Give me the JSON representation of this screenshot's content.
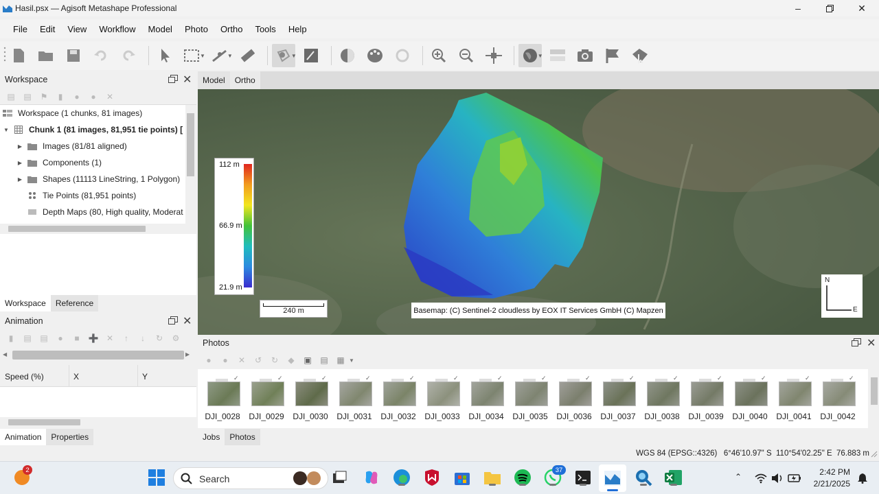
{
  "window": {
    "title": "Hasil.psx — Agisoft Metashape Professional",
    "controls": [
      "minimize-icon",
      "restore-icon",
      "close-icon"
    ]
  },
  "menubar": {
    "items": [
      {
        "label": "File"
      },
      {
        "label": "Edit"
      },
      {
        "label": "View"
      },
      {
        "label": "Workflow"
      },
      {
        "label": "Model"
      },
      {
        "label": "Photo"
      },
      {
        "label": "Ortho"
      },
      {
        "label": "Tools"
      },
      {
        "label": "Help"
      }
    ]
  },
  "toolbar": {
    "icons": [
      "new-document-icon",
      "open-folder-icon",
      "save-icon",
      "undo-icon",
      "redo-icon",
      "select-pointer-icon",
      "rectangle-selection-icon",
      "ruler-line-icon",
      "ruler-icon",
      "shape-draw-icon",
      "edit-patch-icon",
      "hillshade-icon",
      "palette-icon",
      "refresh-icon",
      "zoom-in-icon",
      "zoom-out-icon",
      "move-icon",
      "globe-icon",
      "layers-icon",
      "camera-icon",
      "flag-icon",
      "shape-select-icon"
    ]
  },
  "workspace": {
    "title": "Workspace",
    "root": "Workspace (1 chunks, 81 images)",
    "chunk": "Chunk 1 (81 images, 81,951 tie points) [",
    "items": [
      {
        "label": "Images (81/81 aligned)",
        "icon": "folder-icon"
      },
      {
        "label": "Components (1)",
        "icon": "folder-icon"
      },
      {
        "label": "Shapes (11113 LineString, 1 Polygon)",
        "icon": "folder-icon"
      },
      {
        "label": "Tie Points (81,951 points)",
        "icon": "tie-points-icon"
      },
      {
        "label": "Depth Maps (80, High quality, Moderat",
        "icon": "depth-maps-icon"
      }
    ],
    "tabs": [
      {
        "label": "Workspace",
        "selected": true
      },
      {
        "label": "Reference",
        "selected": false
      }
    ]
  },
  "animation": {
    "title": "Animation",
    "columns": [
      "Speed (%)",
      "X",
      "Y"
    ],
    "tabs": [
      {
        "label": "Animation",
        "selected": true
      },
      {
        "label": "Properties",
        "selected": false
      }
    ]
  },
  "view": {
    "tabs": [
      {
        "label": "Model",
        "selected": false
      },
      {
        "label": "Ortho",
        "selected": true
      }
    ],
    "legend": {
      "max": "112 m",
      "mid": "66.9 m",
      "min": "21.9 m"
    },
    "scale": "240 m",
    "attribution": "Basemap: (C) Sentinel-2 cloudless by EOX IT Services GmbH (C) Mapzen",
    "compass": {
      "north": "N",
      "east": "E"
    }
  },
  "photos": {
    "title": "Photos",
    "items": [
      "DJI_0028",
      "DJI_0029",
      "DJI_0030",
      "DJI_0031",
      "DJI_0032",
      "DJI_0033",
      "DJI_0034",
      "DJI_0035",
      "DJI_0036",
      "DJI_0037",
      "DJI_0038",
      "DJI_0039",
      "DJI_0040",
      "DJI_0041",
      "DJI_0042"
    ],
    "tabs": [
      {
        "label": "Jobs",
        "selected": false
      },
      {
        "label": "Photos",
        "selected": true
      }
    ]
  },
  "status": {
    "text": "WGS 84 (EPSG::4326)   6°46'10.97\" S  110°54'02.25\" E  76.883 m"
  },
  "taskbar": {
    "search_placeholder": "Search",
    "time": "2:42 PM",
    "date": "2/21/2025",
    "badges": {
      "notifications": "2",
      "whatsapp": "37"
    }
  }
}
